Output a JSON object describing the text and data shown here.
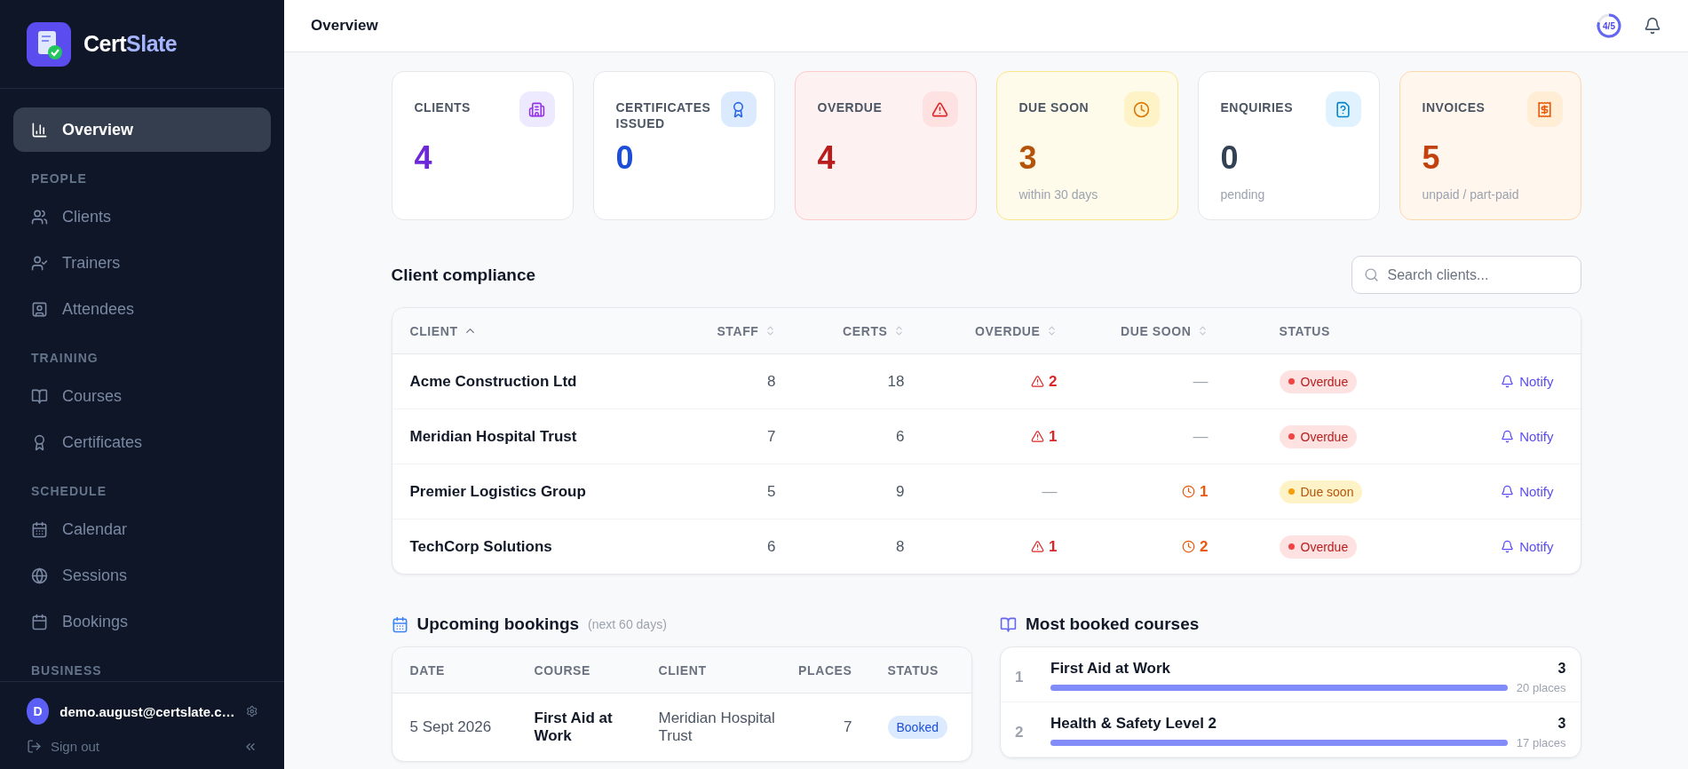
{
  "brand": {
    "first": "Cert",
    "second": "Slate"
  },
  "sidebar": {
    "sections": [
      {
        "items": [
          {
            "label": "Overview",
            "selected": true
          }
        ]
      },
      {
        "title": "PEOPLE",
        "items": [
          {
            "label": "Clients",
            "selected": false
          },
          {
            "label": "Trainers",
            "selected": false
          },
          {
            "label": "Attendees",
            "selected": false
          }
        ]
      },
      {
        "title": "TRAINING",
        "items": [
          {
            "label": "Courses",
            "selected": false
          },
          {
            "label": "Certificates",
            "selected": false
          }
        ]
      },
      {
        "title": "SCHEDULE",
        "items": [
          {
            "label": "Calendar",
            "selected": false
          },
          {
            "label": "Sessions",
            "selected": false
          },
          {
            "label": "Bookings",
            "selected": false
          }
        ]
      },
      {
        "title": "BUSINESS"
      }
    ],
    "user": {
      "initial": "D",
      "email": "demo.august@certslate.c…"
    },
    "sign_out": "Sign out"
  },
  "header": {
    "title": "Overview",
    "progress": {
      "text": "4/5",
      "level": 0.8
    }
  },
  "stats": [
    {
      "label": "CLIENTS",
      "value": "4",
      "color": "#6d28d9"
    },
    {
      "label": "CERTIFICATES ISSUED",
      "value": "0",
      "color": "#1d4ed8"
    },
    {
      "label": "OVERDUE",
      "value": "4",
      "color": "#b91c1c"
    },
    {
      "label": "DUE SOON",
      "value": "3",
      "sub": "within 30 days",
      "color": "#b45309"
    },
    {
      "label": "ENQUIRIES",
      "value": "0",
      "sub": "pending",
      "color": "#334155"
    },
    {
      "label": "INVOICES",
      "value": "5",
      "sub": "unpaid / part-paid",
      "color": "#c2410c"
    }
  ],
  "compliance": {
    "title": "Client compliance",
    "search": {
      "placeholder": "Search clients..."
    },
    "columns": [
      {
        "label": "CLIENT",
        "sortable": true,
        "sorted": true
      },
      {
        "label": "STAFF",
        "sortable": true,
        "sorted": false
      },
      {
        "label": "CERTS",
        "sortable": true,
        "sorted": false
      },
      {
        "label": "OVERDUE",
        "sortable": true,
        "sorted": false
      },
      {
        "label": "DUE SOON",
        "sortable": true,
        "sorted": false
      },
      {
        "label": "STATUS",
        "sortable": false
      }
    ],
    "rows": [
      {
        "client": "Acme Construction Ltd",
        "staff": "8",
        "certs": "18",
        "overdue": {
          "kind": "alert",
          "text": "2"
        },
        "due_soon": {
          "kind": "none",
          "text": "—"
        },
        "status": {
          "kind": "overdue",
          "label": "Overdue"
        },
        "action": "Notify"
      },
      {
        "client": "Meridian Hospital Trust",
        "staff": "7",
        "certs": "6",
        "overdue": {
          "kind": "alert",
          "text": "1"
        },
        "due_soon": {
          "kind": "none",
          "text": "—"
        },
        "status": {
          "kind": "overdue",
          "label": "Overdue"
        },
        "action": "Notify"
      },
      {
        "client": "Premier Logistics Group",
        "staff": "5",
        "certs": "9",
        "overdue": {
          "kind": "none",
          "text": "—"
        },
        "due_soon": {
          "kind": "clock",
          "text": "1"
        },
        "status": {
          "kind": "due",
          "label": "Due soon"
        },
        "action": "Notify"
      },
      {
        "client": "TechCorp Solutions",
        "staff": "6",
        "certs": "8",
        "overdue": {
          "kind": "alert",
          "text": "1"
        },
        "due_soon": {
          "kind": "clock",
          "text": "2"
        },
        "status": {
          "kind": "overdue",
          "label": "Overdue"
        },
        "action": "Notify"
      }
    ]
  },
  "bookings": {
    "title": "Upcoming bookings",
    "note": "(next 60 days)",
    "columns": [
      "DATE",
      "COURSE",
      "CLIENT",
      "PLACES",
      "STATUS"
    ],
    "rows": [
      {
        "date": "5 Sept 2026",
        "course": "First Aid at Work",
        "client": "Meridian Hospital Trust",
        "places": "7",
        "status": "Booked"
      }
    ]
  },
  "courses": {
    "title": "Most booked courses",
    "items": [
      {
        "rank": "1",
        "name": "First Aid at Work",
        "count": "3",
        "places": "20 places",
        "level": 1
      },
      {
        "rank": "2",
        "name": "Health & Safety Level 2",
        "count": "3",
        "places": "17 places",
        "level": 1
      }
    ]
  }
}
